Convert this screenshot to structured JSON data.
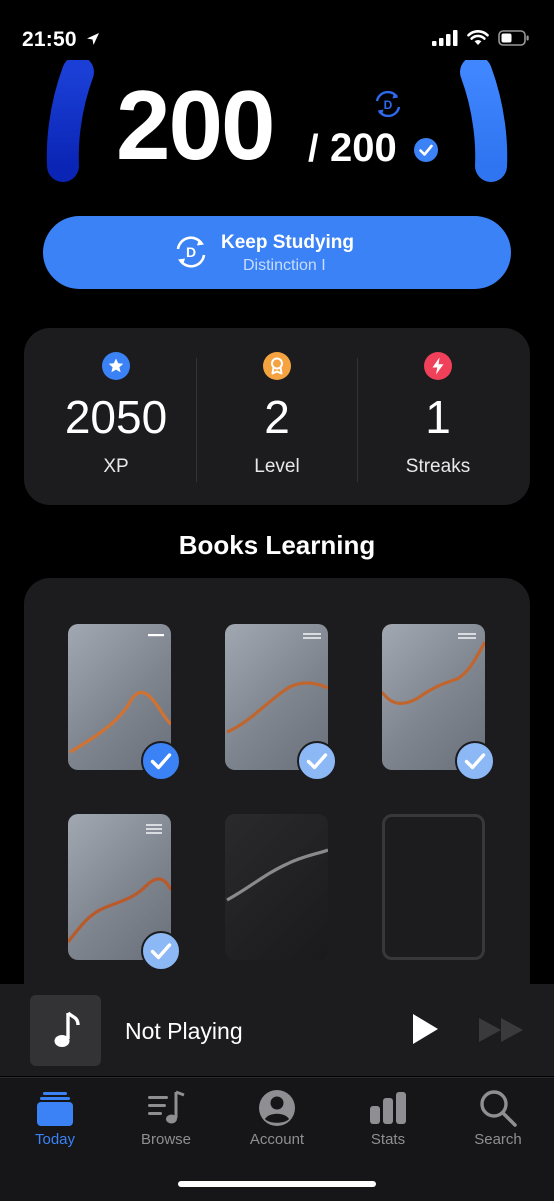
{
  "status_bar": {
    "time": "21:50"
  },
  "score": {
    "current": "200",
    "separator": "/",
    "total": "200"
  },
  "keep_button": {
    "title": "Keep Studying",
    "subtitle": "Distinction I",
    "badge_letter": "D"
  },
  "stats": [
    {
      "value": "2050",
      "label": "XP",
      "icon": "star-icon",
      "color": "#3b82f6"
    },
    {
      "value": "2",
      "label": "Level",
      "icon": "award-icon",
      "color": "#f4a340"
    },
    {
      "value": "1",
      "label": "Streaks",
      "icon": "lightning-icon",
      "color": "#f0405a"
    }
  ],
  "books": {
    "title": "Books Learning",
    "items": [
      {
        "state": "completed",
        "check": "strong"
      },
      {
        "state": "completed",
        "check": "light"
      },
      {
        "state": "completed",
        "check": "light"
      },
      {
        "state": "completed",
        "check": "light"
      },
      {
        "state": "in-progress"
      },
      {
        "state": "empty"
      }
    ]
  },
  "player": {
    "status": "Not Playing"
  },
  "tabs": [
    {
      "label": "Today",
      "icon": "today-icon",
      "active": true
    },
    {
      "label": "Browse",
      "icon": "browse-icon",
      "active": false
    },
    {
      "label": "Account",
      "icon": "account-icon",
      "active": false
    },
    {
      "label": "Stats",
      "icon": "stats-icon",
      "active": false
    },
    {
      "label": "Search",
      "icon": "search-icon",
      "active": false
    }
  ],
  "colors": {
    "accent": "#3b82f6",
    "background": "#000000",
    "card": "#1c1c1e"
  }
}
